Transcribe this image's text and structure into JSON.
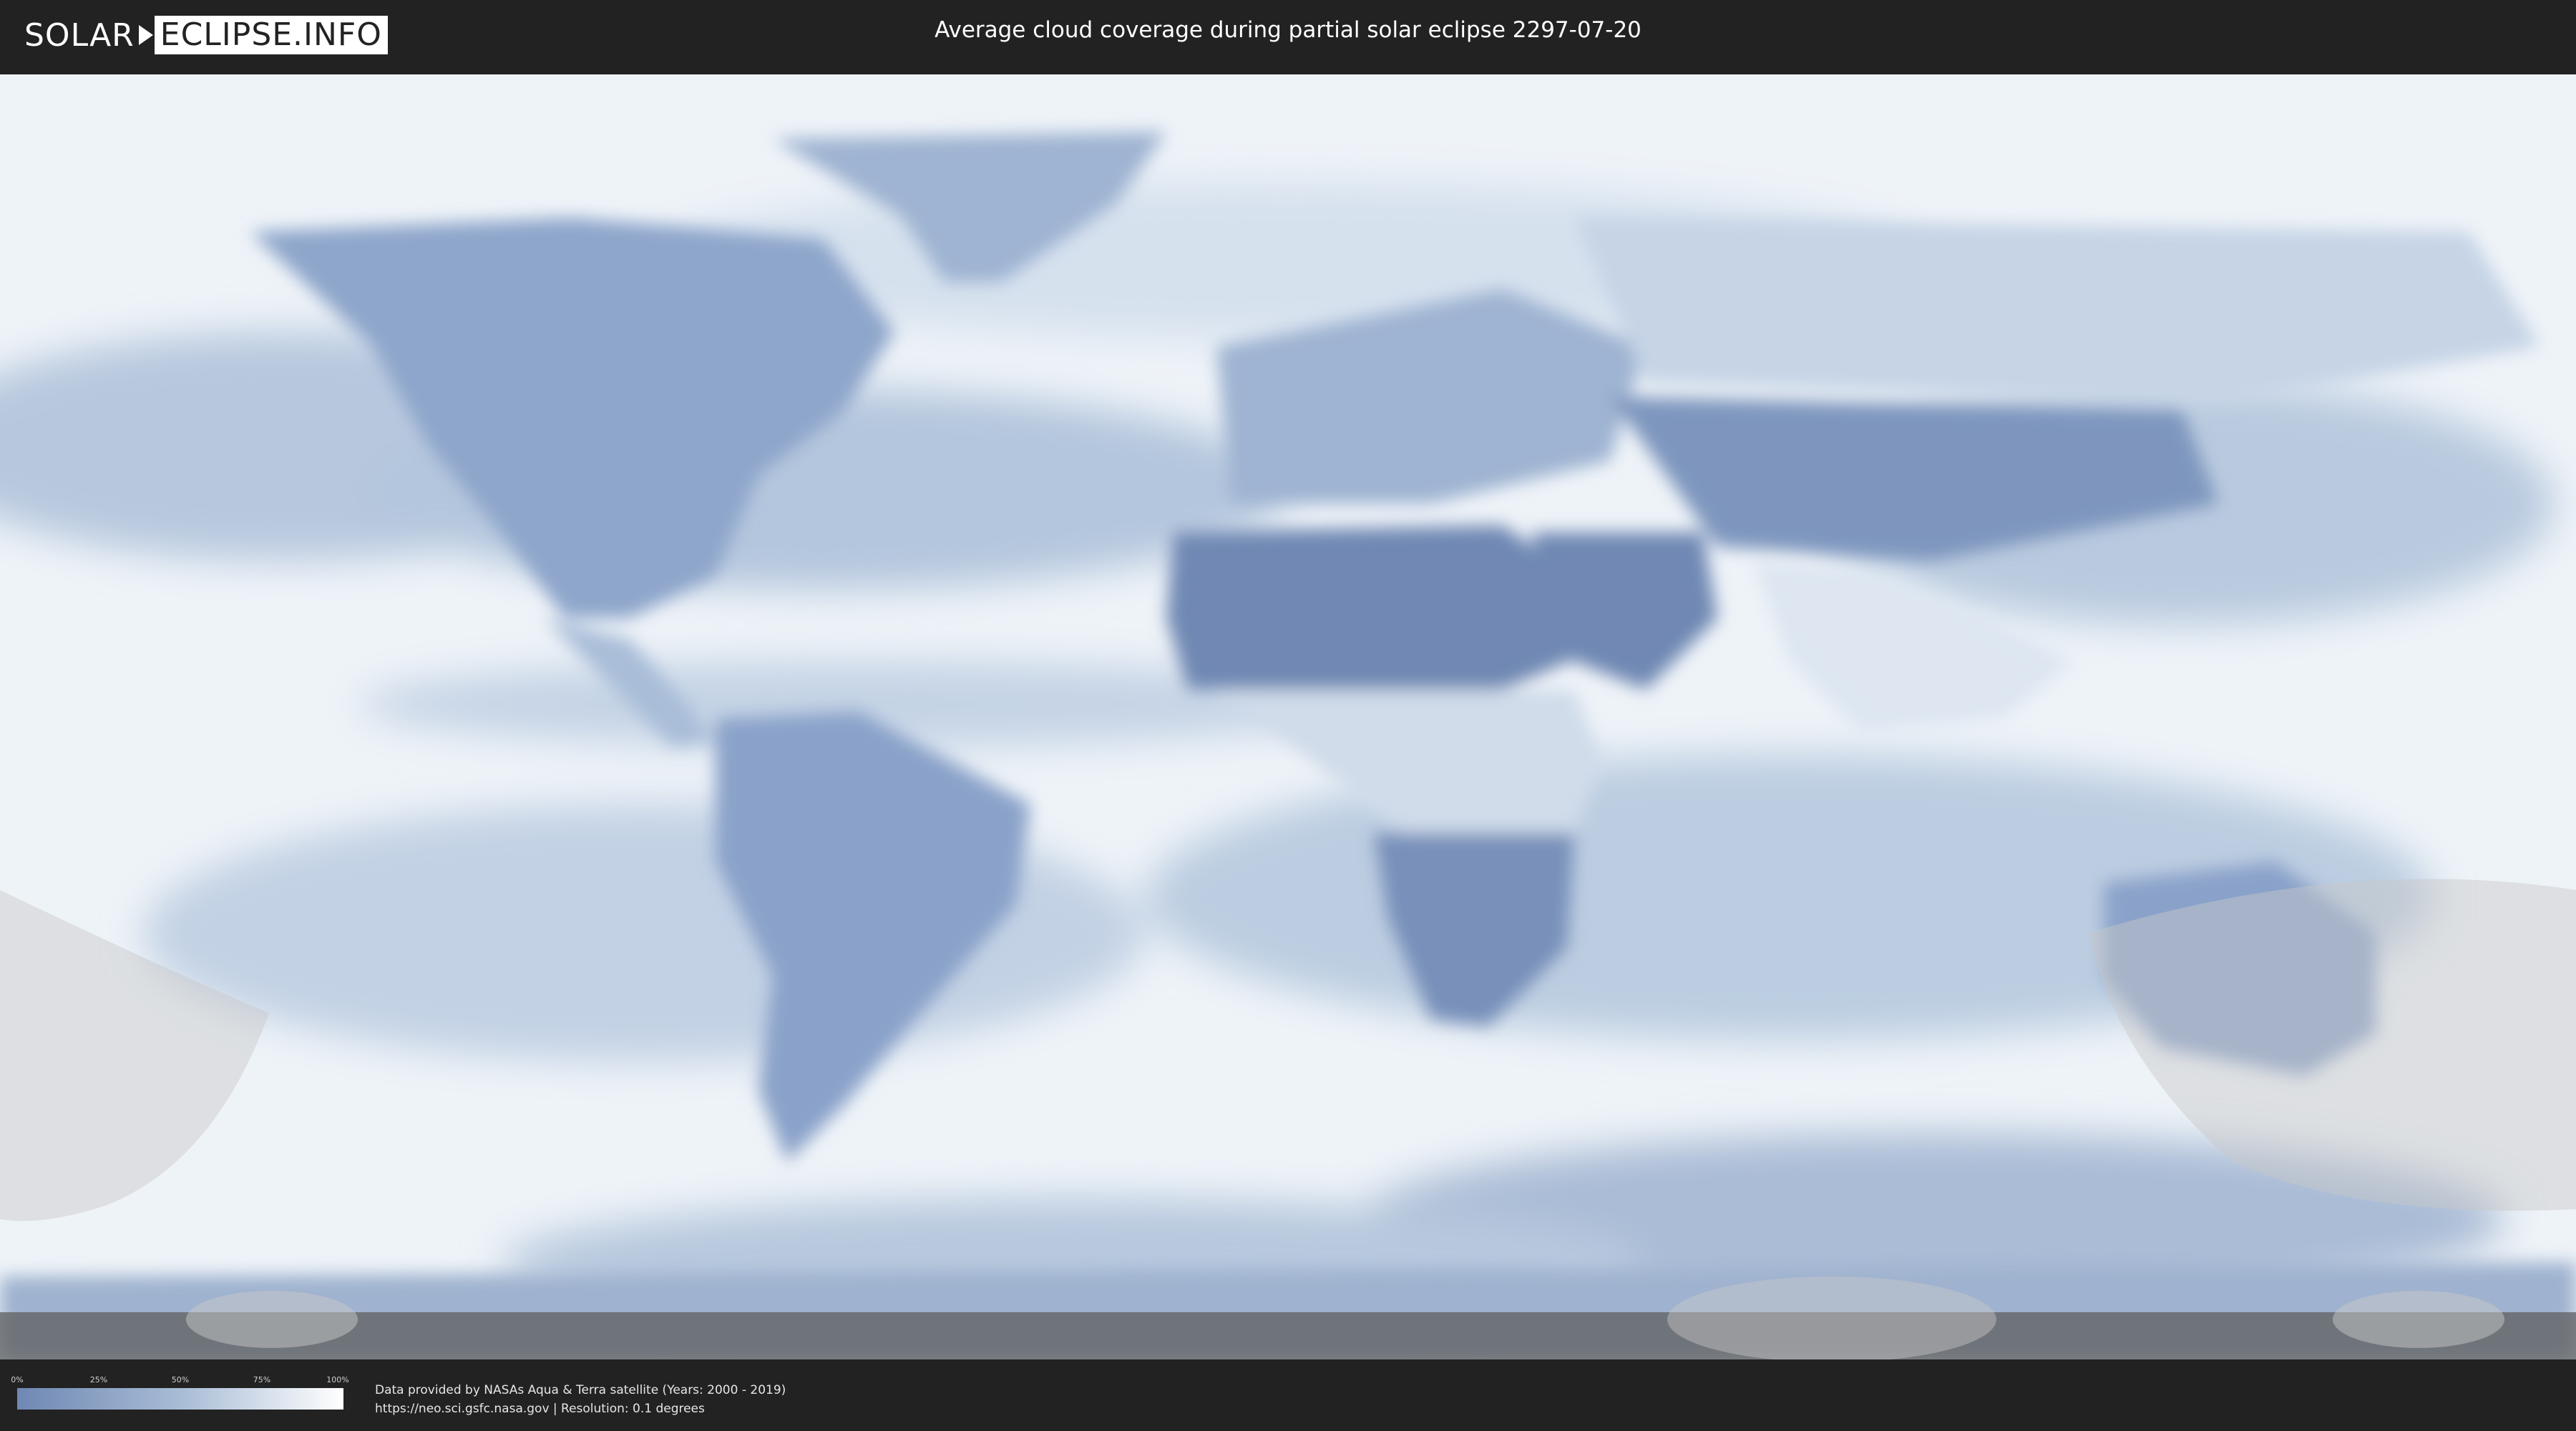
{
  "header": {
    "logo_left": "SOLAR",
    "logo_right": "ECLIPSE.INFO",
    "title": "Average cloud coverage during partial solar eclipse 2297-07-20"
  },
  "legend": {
    "ticks": [
      "0%",
      "25%",
      "50%",
      "75%",
      "100%"
    ],
    "tick_values": [
      0,
      25,
      50,
      75,
      100
    ],
    "color_low": "#6f88b3",
    "color_mid": "#a8bcd6",
    "color_high": "#ffffff"
  },
  "footer": {
    "credit_line_1": "Data provided by NASAs Aqua & Terra satellite (Years: 2000 - 2019)",
    "credit_line_2": "https://neo.sci.gsfc.nasa.gov | Resolution: 0.1 degrees"
  },
  "colors": {
    "background": "#222222",
    "map_base": "#eef3f8",
    "clear_sky": "#6f88b3",
    "eclipse_shadow": "#c8c8c8"
  }
}
